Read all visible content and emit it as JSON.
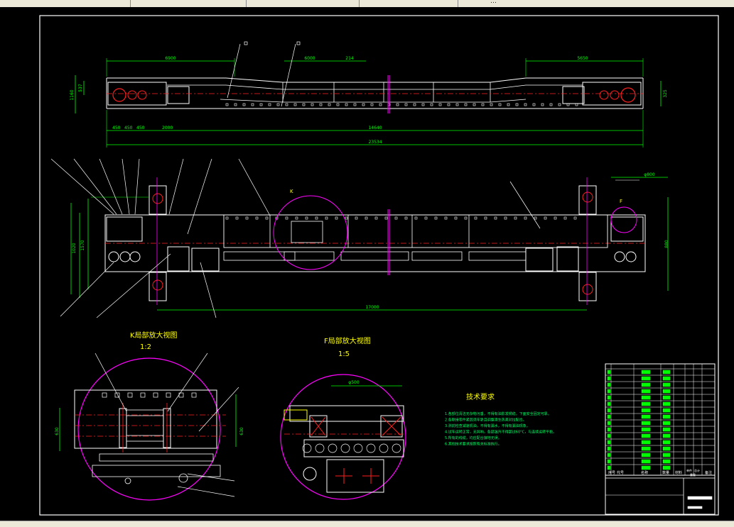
{
  "topbar": {
    "tabs": [
      "",
      "",
      "",
      "",
      ""
    ],
    "tab_last": "…"
  },
  "drawing": {
    "k_detail_title": "K局部放大视图",
    "k_detail_scale": "1:2",
    "f_detail_title": "F局部放大视图",
    "f_detail_scale": "1:5",
    "tech_title": "技术要求",
    "tech_items": [
      "1.各部位清洁无杂物污垂，不得有油影发锈稳，下面安全固定可靠。",
      "2.各联接零件紧固须牢靠且调整澳生热美对拉配合。",
      "3.测前检查减速机油，不得有漏水，不得有漏油现象。",
      "4.试车运转正常，无异响，各部温升不得超过60°C，与连续运转平稳。",
      "5.所有的线缆，均应配合接地无误。",
      "6.其他技术要求按照有关标准执行。"
    ],
    "dims": {
      "top_left_len": "6900",
      "top_mid_a": "6000",
      "top_mid_b": "214",
      "top_right_len": "5650",
      "left_h1": "1160",
      "left_h2": "537",
      "right_h": "325",
      "bot_a": "450",
      "bot_b": "450",
      "bot_c": "450",
      "bot_d": "2000",
      "bot_mid": "14640",
      "total": "23534",
      "plan_w1": "1020",
      "plan_w2": "1570",
      "plan_w3": "880",
      "plan_len": "17000",
      "plan_r": "1550",
      "plan_tag": "φ800",
      "k_h": "630",
      "k_h2": "630",
      "f_w": "φ500"
    },
    "view_tags": {
      "k": "K",
      "f": "F"
    },
    "title_block": {
      "col_no": "序号",
      "col_code": "代号",
      "col_name": "名称",
      "col_qty": "数量",
      "col_mat": "材料",
      "col_unit": "单件",
      "col_total": "总计",
      "col_weight": "重量",
      "col_note": "备注"
    }
  },
  "colors": {
    "background": "#000000",
    "geometry": "#ffffff",
    "dimension": "#00ff00",
    "center_line": "#ff2020",
    "detail_circle": "#ff00ff",
    "text_yellow": "#ffff00",
    "note_green": "#00ff66"
  }
}
